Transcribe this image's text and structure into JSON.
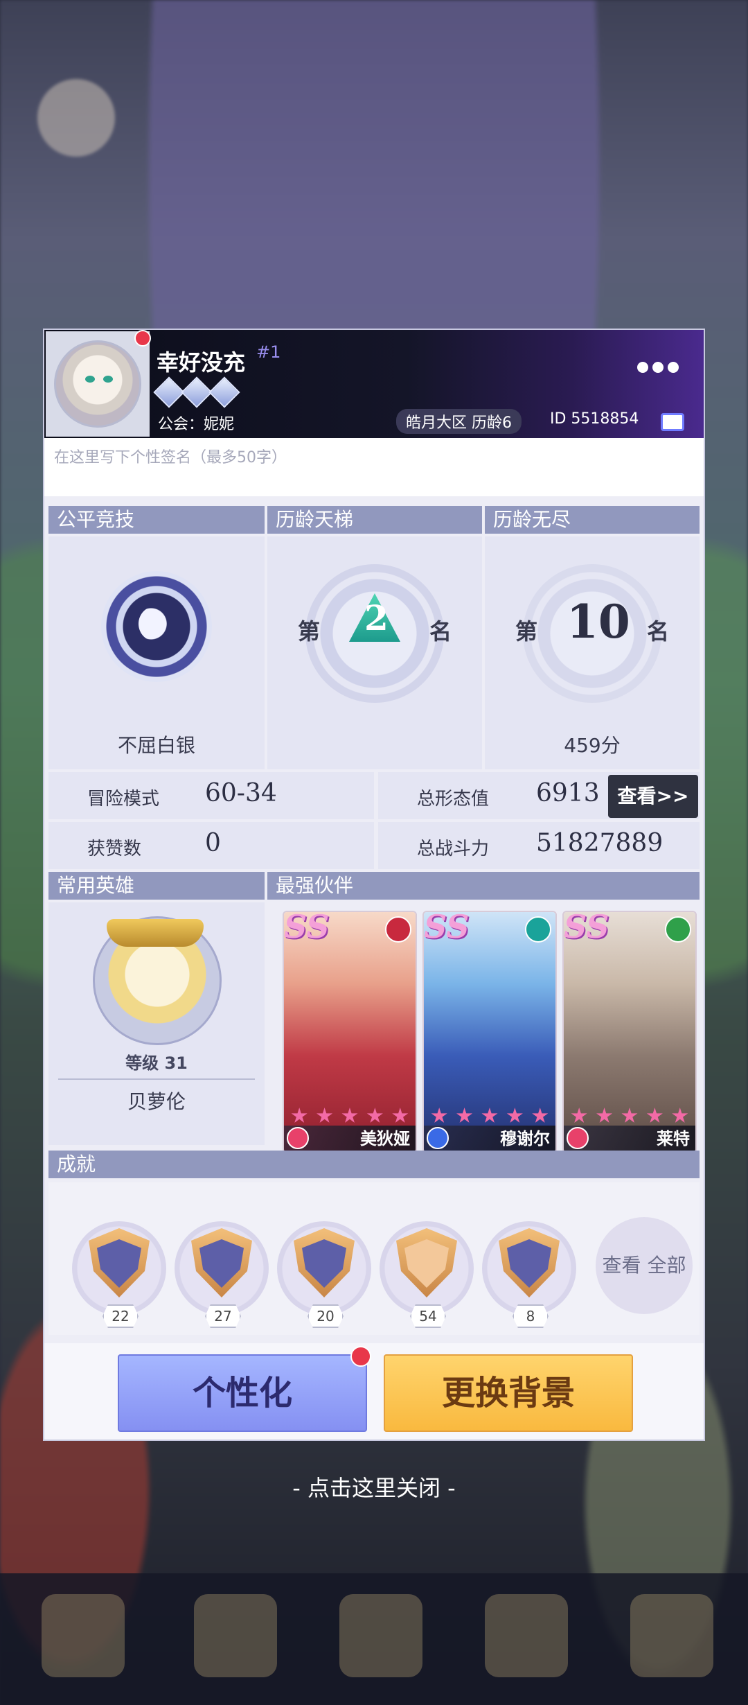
{
  "profile": {
    "name": "幸好没充",
    "rank_tag": "#1",
    "guild": "公会：妮妮",
    "server": "皓月大区 历龄6",
    "player_id": "ID 5518854",
    "signature_placeholder": "在这里写下个性签名（最多50字）"
  },
  "competitive": [
    {
      "title": "公平竞技",
      "value": "不屈白银"
    },
    {
      "title": "历龄天梯",
      "prefix": "第",
      "rank": "2",
      "suffix": "名"
    },
    {
      "title": "历龄无尽",
      "prefix": "第",
      "rank": "10",
      "suffix": "名",
      "value": "459分"
    }
  ],
  "stats": {
    "adventure_label": "冒险模式",
    "adventure_value": "60-34",
    "likes_label": "获赞数",
    "likes_value": "0",
    "appearance_label": "总形态值",
    "appearance_value": "6913",
    "power_label": "总战斗力",
    "power_value": "51827889",
    "view_button": "查看>>"
  },
  "hero": {
    "section_title": "常用英雄",
    "level": "等级 31",
    "name": "贝萝伦"
  },
  "partners": {
    "section_title": "最强伙伴",
    "cards": [
      {
        "grade": "SS",
        "name": "美狄娅",
        "stars": 5,
        "element_color": "#c8293e",
        "class_color": "#e8416a"
      },
      {
        "grade": "SS",
        "name": "穆谢尔",
        "stars": 5,
        "element_color": "#1aa39a",
        "class_color": "#3a6ae6"
      },
      {
        "grade": "SS",
        "name": "莱特",
        "stars": 5,
        "element_color": "#2fa04a",
        "class_color": "#e8416a"
      }
    ]
  },
  "achievements": {
    "section_title": "成就",
    "counts": [
      "22",
      "27",
      "20",
      "54",
      "8"
    ],
    "view_all": "查看 全部"
  },
  "buttons": {
    "personalize": "个性化",
    "change_background": "更换背景"
  },
  "close_hint": "- 点击这里关闭 -"
}
